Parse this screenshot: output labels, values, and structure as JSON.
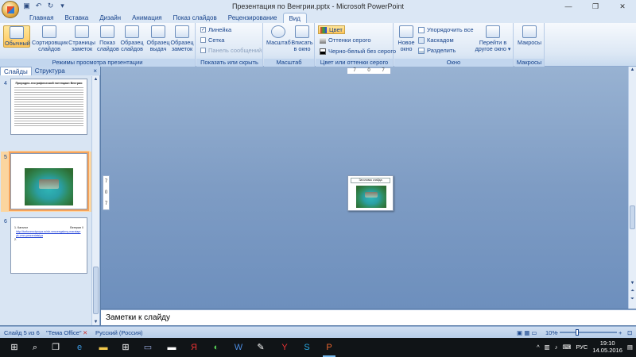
{
  "window": {
    "title": "Презентация по Венгрии.pptx - Microsoft PowerPoint",
    "controls": [
      "—",
      "❐",
      "✕"
    ]
  },
  "tabs": [
    "Главная",
    "Вставка",
    "Дизайн",
    "Анимация",
    "Показ слайдов",
    "Рецензирование",
    "Вид"
  ],
  "active_tab": "Вид",
  "ribbon": {
    "views": {
      "label": "Режимы просмотра презентации",
      "buttons": [
        {
          "l1": "Обычный",
          "l2": ""
        },
        {
          "l1": "Сортировщик",
          "l2": "слайдов"
        },
        {
          "l1": "Страницы",
          "l2": "заметок"
        },
        {
          "l1": "Показ",
          "l2": "слайдов"
        },
        {
          "l1": "Образец",
          "l2": "слайдов"
        },
        {
          "l1": "Образец",
          "l2": "выдач"
        },
        {
          "l1": "Образец",
          "l2": "заметок"
        }
      ]
    },
    "show_hide": {
      "label": "Показать или скрыть",
      "ruler": "Линейка",
      "grid": "Сетка",
      "message_bar": "Панель сообщений"
    },
    "zoom": {
      "label": "Масштаб",
      "zoom_btn": "Масштаб",
      "fit_l1": "Вписать",
      "fit_l2": "в окно"
    },
    "color": {
      "label": "Цвет или оттенки серого",
      "color": "Цвет",
      "grayscale": "Оттенки серого",
      "bw": "Черно-белый без серого"
    },
    "window": {
      "label": "Окно",
      "new_l1": "Новое",
      "new_l2": "окно",
      "arrange": "Упорядочить все",
      "cascade": "Каскадом",
      "split": "Разделить",
      "switch_l1": "Перейти в",
      "switch_l2": "другое окно ▾"
    },
    "macros": {
      "label": "Макросы",
      "btn": "Макросы"
    }
  },
  "panel": {
    "tab_slides": "Слайды",
    "tab_outline": "Структура",
    "close": "×",
    "slides": [
      {
        "num": "4",
        "title": "Природно-географический потенциал Венгрии"
      },
      {
        "num": "5",
        "title": ""
      },
      {
        "num": "6",
        "l1": "1. Каталог",
        "l1b": "Венгрии //",
        "link": "http://turfovenciyvoya.ru/sb-venzeegskmy-maraiapryk-vmn.prezentatsiya",
        "l3": "2."
      }
    ]
  },
  "workspace": {
    "ruler_h": [
      "7",
      "0",
      "7"
    ],
    "ruler_v": [
      "7",
      "0",
      "7"
    ],
    "slide_title": "Заголовок слайда"
  },
  "notes": {
    "placeholder": "Заметки к слайду"
  },
  "status": {
    "slide": "Слайд 5 из 6",
    "theme": "\"Тема Office\"",
    "lang": "Русский (Россия)",
    "zoom": "10%"
  },
  "taskbar": {
    "lang": "РУС",
    "time": "19:10",
    "date": "14.05.2016"
  }
}
